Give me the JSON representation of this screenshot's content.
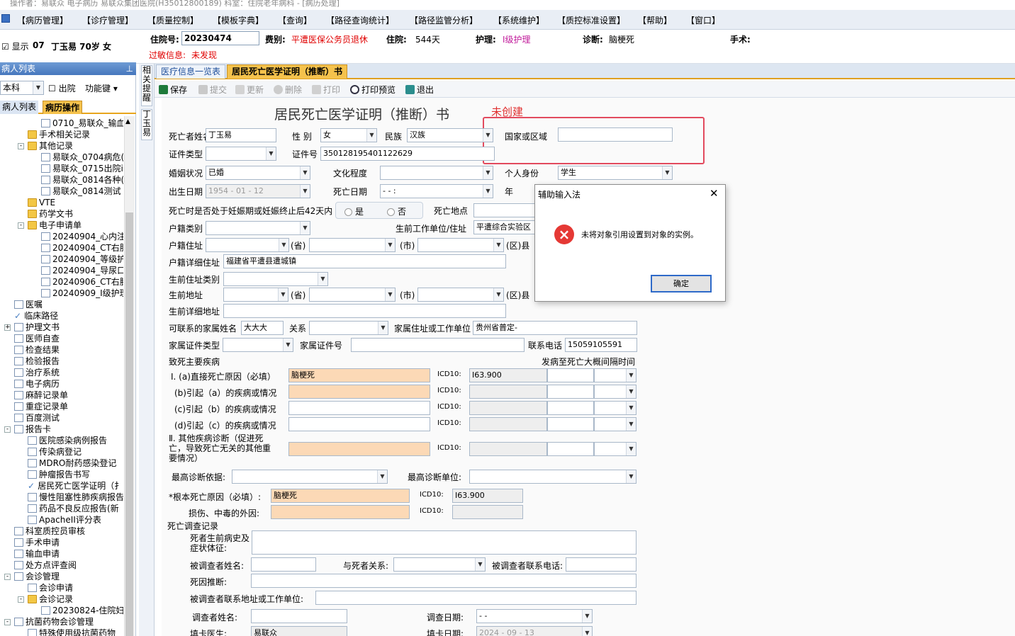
{
  "window": {
    "title": "操作者：易联众 电子病历 易联众集团医院(H35012800189) 科室：住院老年病科 - [病历处理]"
  },
  "menu": [
    "【病历管理】",
    "【诊疗管理】",
    "【质量控制】",
    "【模板字典】",
    "【查询】",
    "【路径查询统计】",
    "【路径监管分析】",
    "【系统维护】",
    "【质控标准设置】",
    "【帮助】",
    "【窗口】"
  ],
  "patient": {
    "show_label": "显示",
    "bed": "07",
    "name_age_sex": "丁玉易 70岁 女",
    "admission_no_label": "住院号:",
    "admission_no": "20230474",
    "fee_type_label": "费别:",
    "fee_type": "平遭医保公务员退休",
    "stay_label": "住院:",
    "stay": "544天",
    "nursing_label": "护理:",
    "nursing": "Ⅰ级护理",
    "diagnosis_label": "诊断:",
    "diagnosis": "脑梗死",
    "surgery_label": "手术:",
    "allergy_label": "过敏信息:",
    "allergy": "未发现"
  },
  "left_panel": {
    "title": "病人列表",
    "dept": "本科",
    "discharged": "出院",
    "function_key": "功能键",
    "tabs": [
      "病人列表",
      "病历操作"
    ],
    "tree": [
      {
        "label": "0710_易联众_输血",
        "icon": "doc",
        "indent": 3
      },
      {
        "label": "手术相关记录",
        "icon": "folder",
        "indent": 2
      },
      {
        "label": "其他记录",
        "icon": "folder",
        "indent": 2,
        "exp": "-"
      },
      {
        "label": "易联众_0704病危(",
        "icon": "doc",
        "indent": 3
      },
      {
        "label": "易联众_0715出院i",
        "icon": "doc",
        "indent": 3
      },
      {
        "label": "易联众_0814各种(",
        "icon": "doc",
        "indent": 3
      },
      {
        "label": "易联众_0814测试",
        "icon": "doc",
        "indent": 3
      },
      {
        "label": "VTE",
        "icon": "folder",
        "indent": 2
      },
      {
        "label": "药学文书",
        "icon": "folder",
        "indent": 2
      },
      {
        "label": "电子申请单",
        "icon": "folder",
        "indent": 2,
        "exp": "-"
      },
      {
        "label": "20240904_心内注射",
        "icon": "doc",
        "indent": 3
      },
      {
        "label": "20240904_CT右肘:",
        "icon": "doc",
        "indent": 3
      },
      {
        "label": "20240904_等级护理",
        "icon": "doc",
        "indent": 3
      },
      {
        "label": "20240904_导尿口扌",
        "icon": "doc",
        "indent": 3
      },
      {
        "label": "20240906_CT右膝:",
        "icon": "doc",
        "indent": 3
      },
      {
        "label": "20240909_Ⅰ级护理",
        "icon": "doc",
        "indent": 3
      },
      {
        "label": "医嘱",
        "icon": "doc",
        "indent": 1
      },
      {
        "label": "临床路径",
        "icon": "chk",
        "indent": 1
      },
      {
        "label": "护理文书",
        "icon": "doc",
        "indent": 1,
        "exp": "+"
      },
      {
        "label": "医师自查",
        "icon": "doc",
        "indent": 1
      },
      {
        "label": "检查结果",
        "icon": "doc",
        "indent": 1
      },
      {
        "label": "检验报告",
        "icon": "doc",
        "indent": 1
      },
      {
        "label": "治疗系统",
        "icon": "doc",
        "indent": 1
      },
      {
        "label": "电子病历",
        "icon": "doc",
        "indent": 1
      },
      {
        "label": "麻醉记录单",
        "icon": "doc",
        "indent": 1
      },
      {
        "label": "重症记录单",
        "icon": "doc",
        "indent": 1
      },
      {
        "label": "百度测试",
        "icon": "doc",
        "indent": 1
      },
      {
        "label": "报告卡",
        "icon": "doc",
        "indent": 1,
        "exp": "-"
      },
      {
        "label": "医院感染病例报告",
        "icon": "doc",
        "indent": 2
      },
      {
        "label": "传染病登记",
        "icon": "doc",
        "indent": 2
      },
      {
        "label": "MDRO耐药感染登记",
        "icon": "doc",
        "indent": 2
      },
      {
        "label": "肿瘤报告书写",
        "icon": "doc",
        "indent": 2
      },
      {
        "label": "居民死亡医学证明（扌",
        "icon": "chk",
        "indent": 2
      },
      {
        "label": "慢性阻塞性肺疾病报告",
        "icon": "doc",
        "indent": 2
      },
      {
        "label": "药品不良反应报告(新",
        "icon": "doc",
        "indent": 2
      },
      {
        "label": "ApacheII评分表",
        "icon": "doc",
        "indent": 2
      },
      {
        "label": "科室质控员审核",
        "icon": "doc",
        "indent": 1
      },
      {
        "label": "手术申请",
        "icon": "doc",
        "indent": 1
      },
      {
        "label": "输血申请",
        "icon": "doc",
        "indent": 1
      },
      {
        "label": "处方点评查阅",
        "icon": "doc",
        "indent": 1
      },
      {
        "label": "会诊管理",
        "icon": "doc",
        "indent": 1,
        "exp": "-"
      },
      {
        "label": "会诊申请",
        "icon": "doc",
        "indent": 2
      },
      {
        "label": "会诊记录",
        "icon": "folder",
        "indent": 2,
        "exp": "-"
      },
      {
        "label": "20230824-住院妇科",
        "icon": "doc",
        "indent": 3
      },
      {
        "label": "抗菌药物会诊管理",
        "icon": "doc",
        "indent": 1,
        "exp": "-"
      },
      {
        "label": "特殊使用级抗菌药物",
        "icon": "doc",
        "indent": 2
      }
    ]
  },
  "side_strip": {
    "related": "相关提醒",
    "patient": "丁玉易"
  },
  "doc_tabs": [
    "医疗信息一览表",
    "居民死亡医学证明（推断）书"
  ],
  "toolbar": {
    "save": "保存",
    "submit": "提交",
    "update": "更新",
    "delete": "删除",
    "print": "打印",
    "print_preview": "打印预览",
    "exit": "退出"
  },
  "form": {
    "title": "居民死亡医学证明（推断）书",
    "annotation": "未创建",
    "deceased_name_label": "死亡者姓名",
    "deceased_name": "丁玉易",
    "sex_label": "性  别",
    "sex": "女",
    "ethnic_label": "民族",
    "ethnic": "汉族",
    "country_label": "国家或区域",
    "country": "",
    "id_type_label": "证件类型",
    "id_no_label": "证件号",
    "id_no": "350128195401122629",
    "marital_label": "婚姻状况",
    "marital": "已婚",
    "education_label": "文化程度",
    "identity_label": "个人身份",
    "identity": "学生",
    "birth_label": "出生日期",
    "birth": "1954 - 01 - 12",
    "death_date_label": "死亡日期",
    "death_date": "-  -      :",
    "year_label": "年",
    "pregnancy_label": "死亡时是否处于妊娠期或妊娠终止后42天内",
    "yes": "是",
    "no": "否",
    "death_place_label": "死亡地点",
    "hukou_type_label": "户籍类别",
    "work_unit_label": "生前工作单位/住址",
    "work_unit": "平遭综合实验区",
    "hukou_addr_label": "户籍住址",
    "prov": "(省)",
    "city": "(市)",
    "county": "(区)县",
    "hukou_detail_label": "户籍详细住址",
    "hukou_detail": "福建省平遭县遭城镇",
    "live_addr_type_label": "生前住址类别",
    "live_addr_label": "生前地址",
    "live_detail_label": "生前详细地址",
    "family_name_label": "可联系的家属姓名",
    "family_name": "大大大",
    "relation_label": "关系",
    "family_addr_label": "家属住址或工作单位",
    "family_addr": "贵州省普定-",
    "family_id_type_label": "家属证件类型",
    "family_id_no_label": "家属证件号",
    "phone_label": "联系电话",
    "phone": "15059105591",
    "cause_label": "致死主要疾病",
    "interval_label": "发病至死亡大概间隔时间",
    "cause_a_label": "Ⅰ. (a)直接死亡原因（必填）",
    "cause_a": "脑梗死",
    "icd_label": "ICD10:",
    "cause_a_icd": "I63.900",
    "cause_b_label": "(b)引起（a）的疾病或情况",
    "cause_c_label": "(c)引起（b）的疾病或情况",
    "cause_d_label": "(d)引起（c）的疾病或情况",
    "other_label": "Ⅱ. 其他疾病诊断（促进死亡，导致死亡无关的其他重要情况）",
    "basis_label": "最高诊断依据:",
    "unit_label": "最高诊断单位:",
    "root_label": "*根本死亡原因（必填）:",
    "root": "脑梗死",
    "root_icd": "I63.900",
    "injury_label": "损伤、中毒的外因:",
    "survey_label": "死亡调查记录",
    "history_label": "死者生前病史及症状体征:",
    "respondent_label": "被调查者姓名:",
    "resp_rel_label": "与死者关系:",
    "resp_phone_label": "被调查者联系电话:",
    "cause_infer_label": "死因推断:",
    "resp_addr_label": "被调查者联系地址或工作单位:",
    "surveyor_label": "调查者姓名:",
    "survey_date_label": "调查日期:",
    "survey_date": "-  -",
    "doctor_label": "填卡医生:",
    "doctor": "易联众",
    "fill_date_label": "填卡日期:",
    "fill_date": "2024 - 09 - 13"
  },
  "dialog": {
    "title": "辅助输入法",
    "message": "未将对象引用设置到对象的实例。",
    "ok": "确定"
  }
}
